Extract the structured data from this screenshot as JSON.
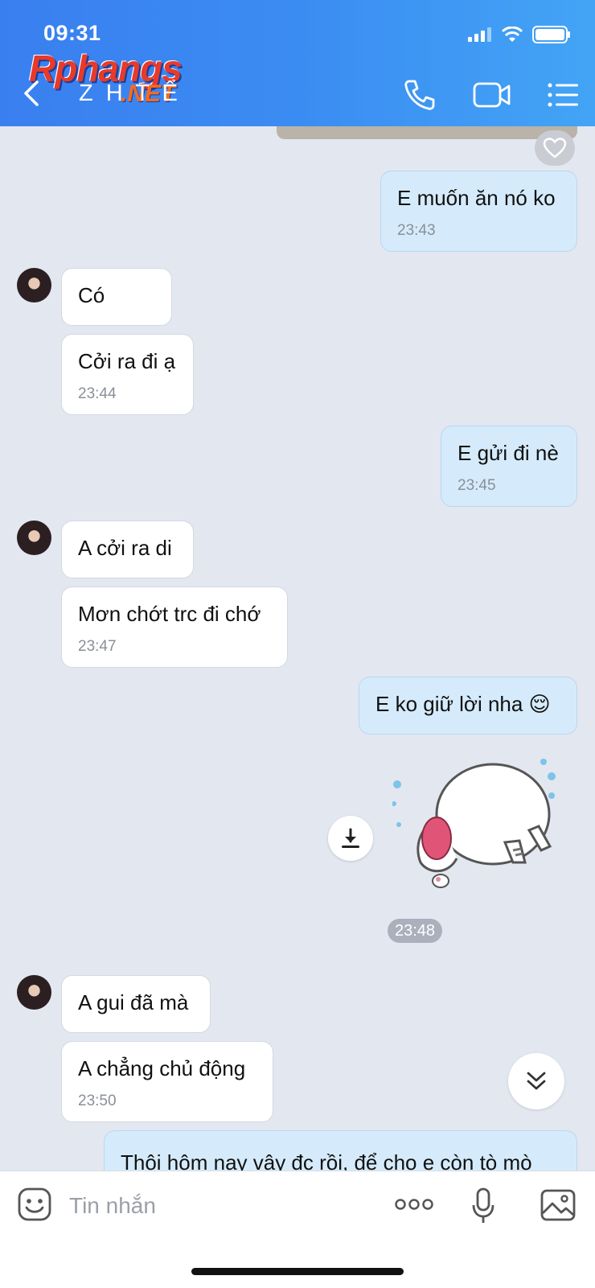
{
  "status_bar": {
    "time": "09:31"
  },
  "watermark": {
    "main": "Rphangs",
    "suffix": ".NET"
  },
  "header": {
    "contact_name": "Z H T Ể"
  },
  "messages": [
    {
      "side": "me",
      "text": "E muốn ăn nó ko",
      "time": "23:43"
    },
    {
      "side": "them",
      "text": "Có",
      "time": ""
    },
    {
      "side": "them",
      "text": "Cởi ra đi ạ",
      "time": "23:44"
    },
    {
      "side": "me",
      "text": "E gửi đi nè",
      "time": "23:45"
    },
    {
      "side": "them",
      "text": "A cởi ra di",
      "time": ""
    },
    {
      "side": "them",
      "text": "Mơn chớt trc đi chớ",
      "time": "23:47"
    },
    {
      "side": "me",
      "text": "E ko giữ lời nha 😌",
      "time": ""
    },
    {
      "side": "them",
      "text": "A gui đã mà",
      "time": ""
    },
    {
      "side": "them",
      "text": "A chẳng chủ động",
      "time": "23:50"
    },
    {
      "side": "me",
      "text": "Thôi hôm nay vậy đc rồi, để cho e còn tò mò",
      "time": ""
    }
  ],
  "sticker_time": "23:48",
  "composer": {
    "placeholder": "Tin nhắn"
  },
  "colors": {
    "header_start": "#3a7ff0",
    "header_end": "#43a4f5",
    "my_bubble": "#d5ebfb",
    "their_bubble": "#ffffff",
    "chat_bg": "#e3e7f0"
  }
}
